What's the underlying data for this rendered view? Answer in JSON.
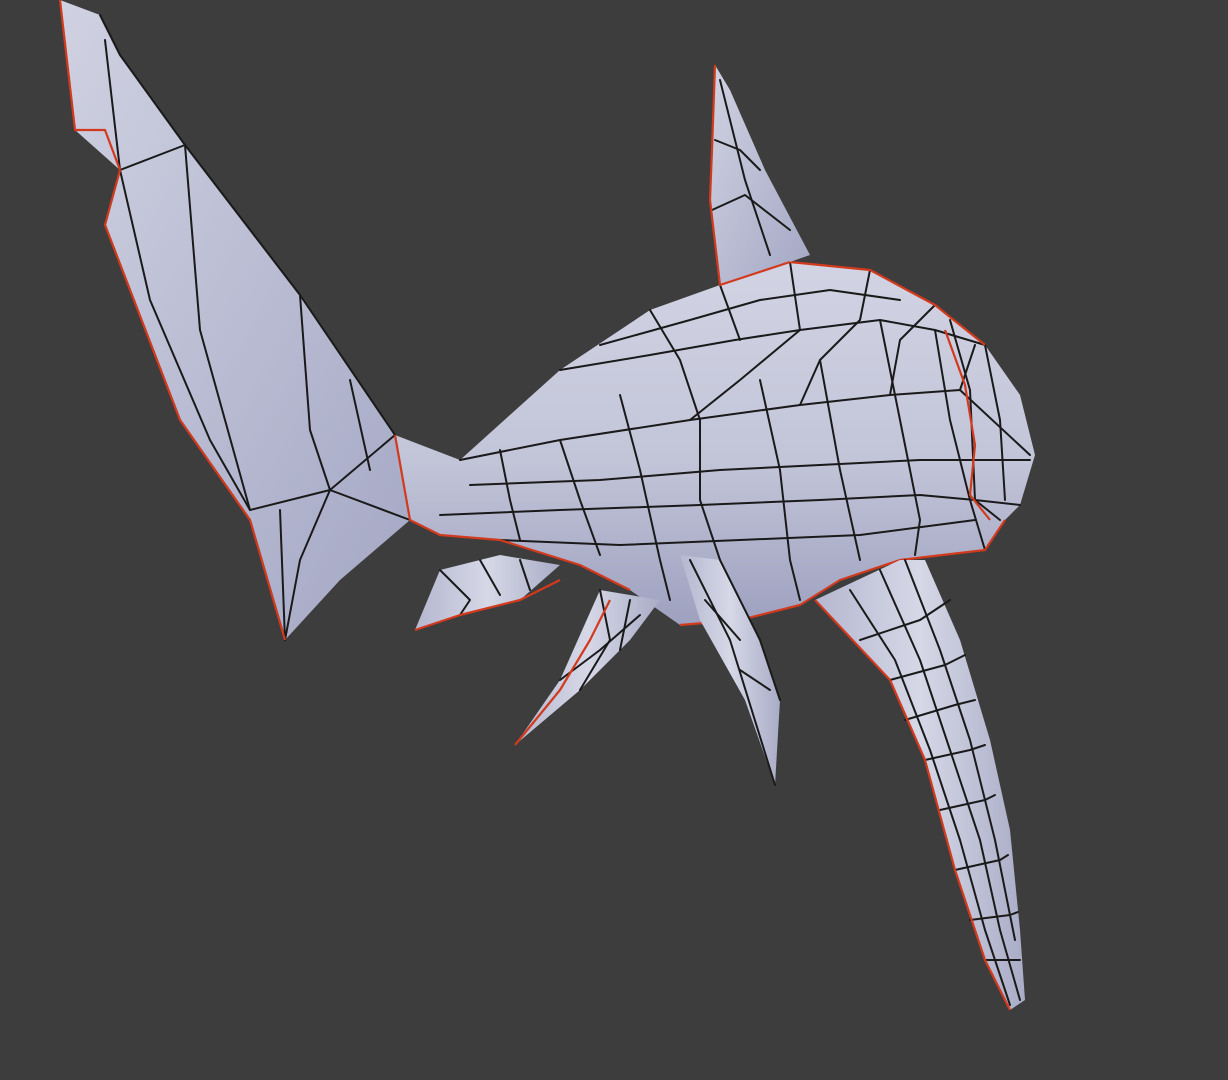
{
  "viewport": {
    "background_color": "#3d3d3d",
    "mesh_color": "#c4c6d8",
    "mesh_shadow_color": "#8c8fae",
    "wire_color": "#1a1a1a",
    "selection_rim_color": "#d23a1e"
  },
  "model": {
    "icon": "shark-mesh-icon"
  }
}
